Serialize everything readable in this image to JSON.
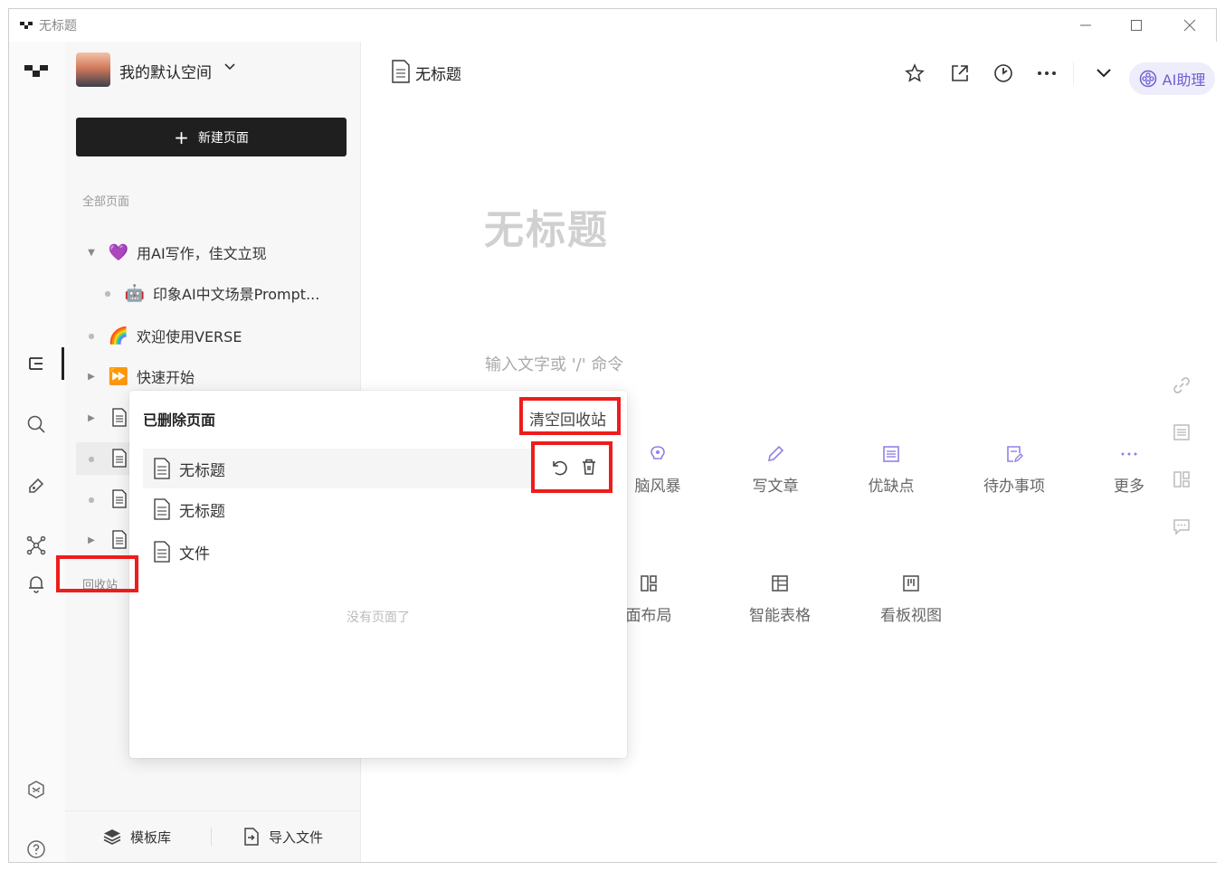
{
  "window": {
    "title": "无标题"
  },
  "workspace": {
    "name": "我的默认空间"
  },
  "sidebar": {
    "new_page_label": "新建页面",
    "section_label": "全部页面",
    "items": [
      {
        "emoji": "💜",
        "label": "用AI写作，佳文立现"
      },
      {
        "emoji": "🤖",
        "label": "印象AI中文场景Prompt..."
      },
      {
        "emoji": "🌈",
        "label": "欢迎使用VERSE"
      },
      {
        "emoji": "⏩",
        "label": "快速开始"
      }
    ],
    "trash_label": "回收站",
    "footer": {
      "templates_label": "模板库",
      "import_label": "导入文件"
    }
  },
  "topbar": {
    "title": "无标题",
    "ai_label": "AI助理"
  },
  "editor": {
    "title_placeholder": "无标题",
    "body_placeholder": "输入文字或 '/' 命令",
    "actions_row1": [
      "脑风暴",
      "写文章",
      "优缺点",
      "待办事项",
      "更多"
    ],
    "actions_row2": [
      "面布局",
      "智能表格",
      "看板视图"
    ]
  },
  "trash_popup": {
    "title": "已删除页面",
    "clear_label": "清空回收站",
    "items": [
      "无标题",
      "无标题",
      "文件"
    ],
    "empty_text": "没有页面了"
  }
}
